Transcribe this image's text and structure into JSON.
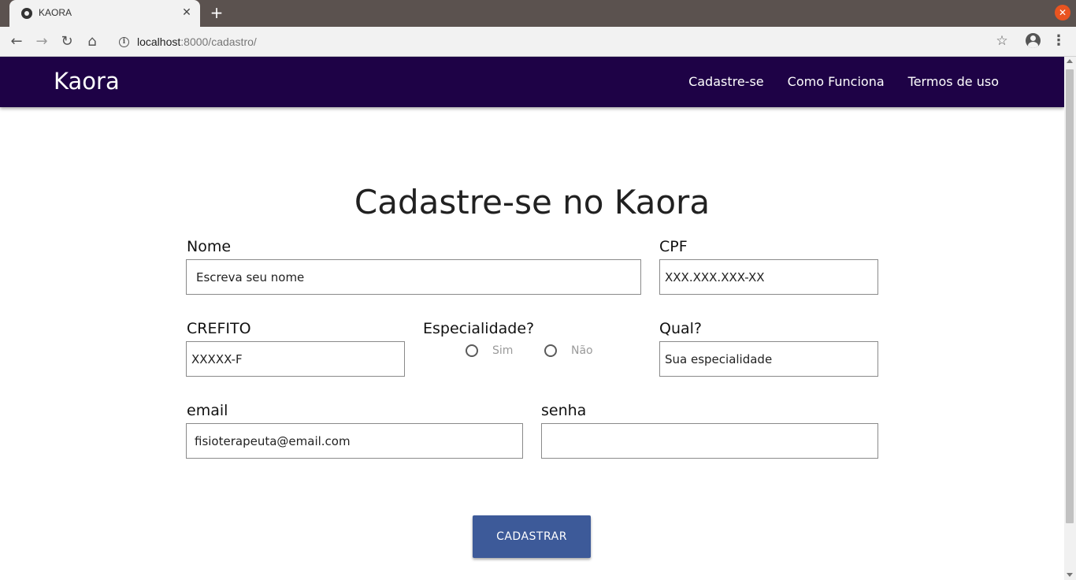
{
  "browser": {
    "tab_title": "KAORA",
    "tab_close": "✕",
    "new_tab": "+",
    "window_close": "✕",
    "url_host": "localhost",
    "url_rest": ":8000/cadastro/",
    "icons": [
      "back-icon",
      "forward-icon",
      "reload-icon",
      "home-icon",
      "info-icon",
      "star-icon",
      "account-icon",
      "menu-icon"
    ]
  },
  "navbar": {
    "brand": "Kaora",
    "links": [
      "Cadastre-se",
      "Como Funciona",
      "Termos de uso"
    ],
    "background": "#1e0246"
  },
  "form": {
    "title": "Cadastre-se no Kaora",
    "nome": {
      "label": "Nome",
      "placeholder": "Escreva seu nome"
    },
    "cpf": {
      "label": "CPF",
      "placeholder": "XXX.XXX.XXX-XX"
    },
    "crefito": {
      "label": "CREFITO",
      "placeholder": "XXXXX-F"
    },
    "especialidade": {
      "label": "Especialidade?",
      "options": [
        "Sim",
        "Não"
      ]
    },
    "qual": {
      "label": "Qual?",
      "placeholder": "Sua especialidade"
    },
    "email": {
      "label": "email",
      "placeholder": "fisioterapeuta@email.com"
    },
    "senha": {
      "label": "senha",
      "placeholder": ""
    },
    "submit": "CADASTRAR",
    "button_color": "#3d5a99"
  }
}
